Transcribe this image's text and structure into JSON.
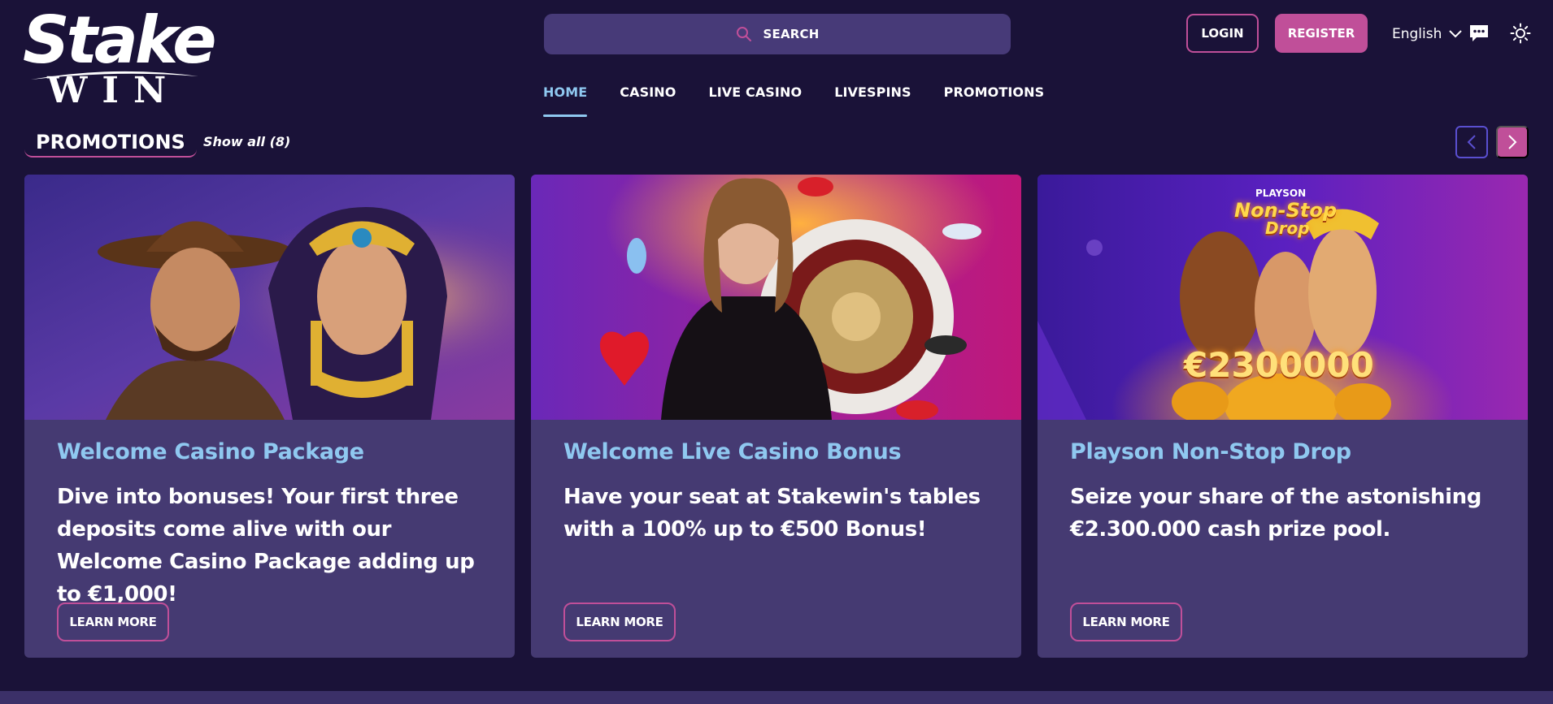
{
  "brand": {
    "logo_top": "Stake",
    "logo_bottom": "WIN"
  },
  "header": {
    "search_label": "SEARCH",
    "login_label": "LOGIN",
    "register_label": "REGISTER",
    "language": "English"
  },
  "nav": {
    "items": [
      {
        "label": "HOME",
        "active": true
      },
      {
        "label": "CASINO",
        "active": false
      },
      {
        "label": "LIVE CASINO",
        "active": false
      },
      {
        "label": "LIVESPINS",
        "active": false
      },
      {
        "label": "PROMOTIONS",
        "active": false
      }
    ]
  },
  "promotions": {
    "title": "PROMOTIONS",
    "show_all": "Show all (8)",
    "cards": [
      {
        "title": "Welcome Casino Package",
        "description": "Dive into bonuses! Your first three deposits come alive with our Welcome Casino Package adding up to €1,000!",
        "button": "LEARN MORE"
      },
      {
        "title": "Welcome Live Casino Bonus",
        "description": "Have your seat at Stakewin's tables with a 100% up to €500 Bonus!",
        "button": "LEARN MORE"
      },
      {
        "title": "Playson Non-Stop Drop",
        "description": "Seize your share of the astonishing €2.300.000 cash prize pool.",
        "button": "LEARN MORE",
        "image_brand": "PLAYSON",
        "image_title_1": "Non-Stop",
        "image_title_2": "Drop",
        "image_amount": "€2300000"
      }
    ]
  },
  "colors": {
    "background": "#1a1238",
    "card": "#453a72",
    "accent_pink": "#c04f99",
    "accent_blue": "#8fc8f0",
    "search_bg": "#473a78"
  },
  "icons": [
    "search-icon",
    "chevron-down-icon",
    "chat-icon",
    "sun-icon",
    "chevron-left-icon",
    "chevron-right-icon"
  ]
}
